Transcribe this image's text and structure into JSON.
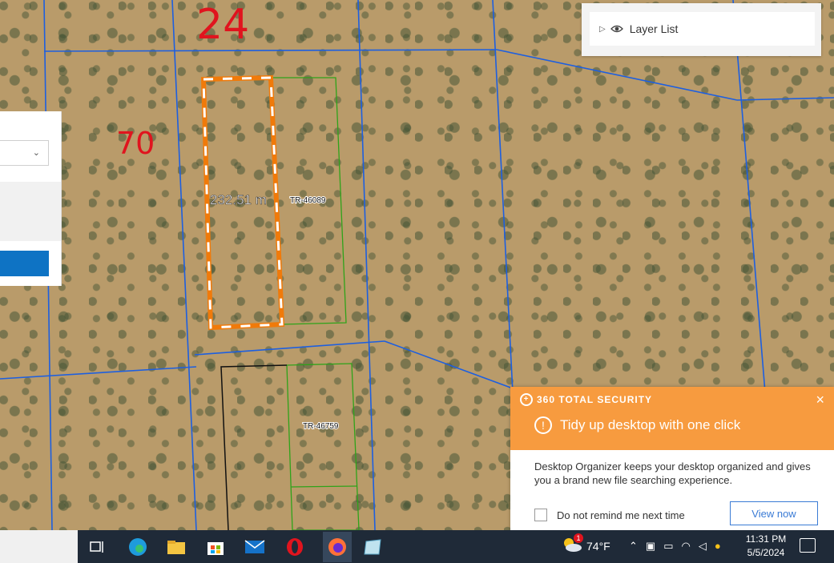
{
  "map": {
    "measurement": "232.51 m",
    "parcels": [
      "TR-46089",
      "TR-46759"
    ],
    "handwritten": [
      "24",
      "70"
    ],
    "colors": {
      "parcel_lines": "#1d5fe0",
      "parcel_green": "#2ea31a",
      "selection": "#f07a0a"
    }
  },
  "layer_list": {
    "label": "Layer List"
  },
  "security_popup": {
    "brand": "360 TOTAL SECURITY",
    "close_label": "×",
    "title": "Tidy up desktop with one click",
    "description": "Desktop Organizer keeps your desktop organized and gives you a brand new file searching experience.",
    "checkbox_label": "Do not remind me next time",
    "button_label": "View now",
    "accent": "#f79b3f"
  },
  "taskbar": {
    "icons": [
      "task-view-icon",
      "edge-icon",
      "file-explorer-icon",
      "store-icon",
      "mail-icon",
      "opera-icon",
      "firefox-icon",
      "notepad-icon"
    ],
    "weather": {
      "temp": "74°F",
      "badge": "1"
    },
    "clock": {
      "time": "11:31 PM",
      "date": "5/5/2024"
    }
  }
}
